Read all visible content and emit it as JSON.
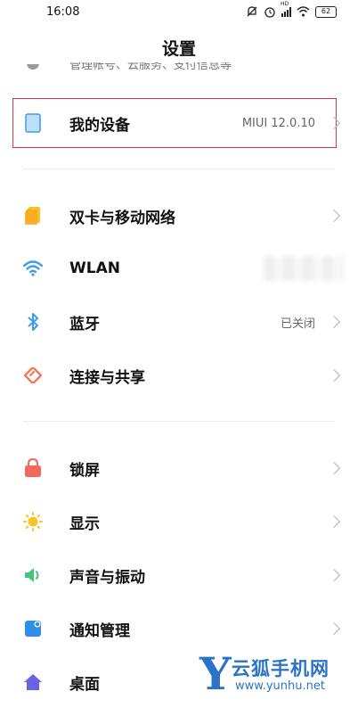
{
  "status_bar": {
    "time": "16:08",
    "signal_label": "HD",
    "battery": "62"
  },
  "header": {
    "title": "设置",
    "scrolled_text": "管理帐号、云服务、支付信息等"
  },
  "rows": [
    {
      "label": "我的设备",
      "value": "MIUI 12.0.10",
      "icon": "tablet-icon",
      "icon_color": "#5aa9e6"
    },
    {
      "label": "双卡与移动网络",
      "value": "",
      "icon": "sim-card-icon",
      "icon_color": "#f6c32b"
    },
    {
      "label": "WLAN",
      "value": "",
      "icon": "wifi-icon",
      "icon_color": "#3e9be9"
    },
    {
      "label": "蓝牙",
      "value": "已关闭",
      "icon": "bluetooth-icon",
      "icon_color": "#3e9be9"
    },
    {
      "label": "连接与共享",
      "value": "",
      "icon": "share-icon",
      "icon_color": "#f07a5b"
    },
    {
      "label": "锁屏",
      "value": "",
      "icon": "lock-icon",
      "icon_color": "#f26a5e"
    },
    {
      "label": "显示",
      "value": "",
      "icon": "sun-icon",
      "icon_color": "#f6c32b"
    },
    {
      "label": "声音与振动",
      "value": "",
      "icon": "speaker-icon",
      "icon_color": "#46c37b"
    },
    {
      "label": "通知管理",
      "value": "",
      "icon": "notification-icon",
      "icon_color": "#2f8fe8"
    },
    {
      "label": "桌面",
      "value": "",
      "icon": "home-icon",
      "icon_color": "#6b61e3"
    }
  ],
  "watermark": {
    "letter": "Y",
    "name": "云狐手机网",
    "url": "www.yunhu.net"
  }
}
